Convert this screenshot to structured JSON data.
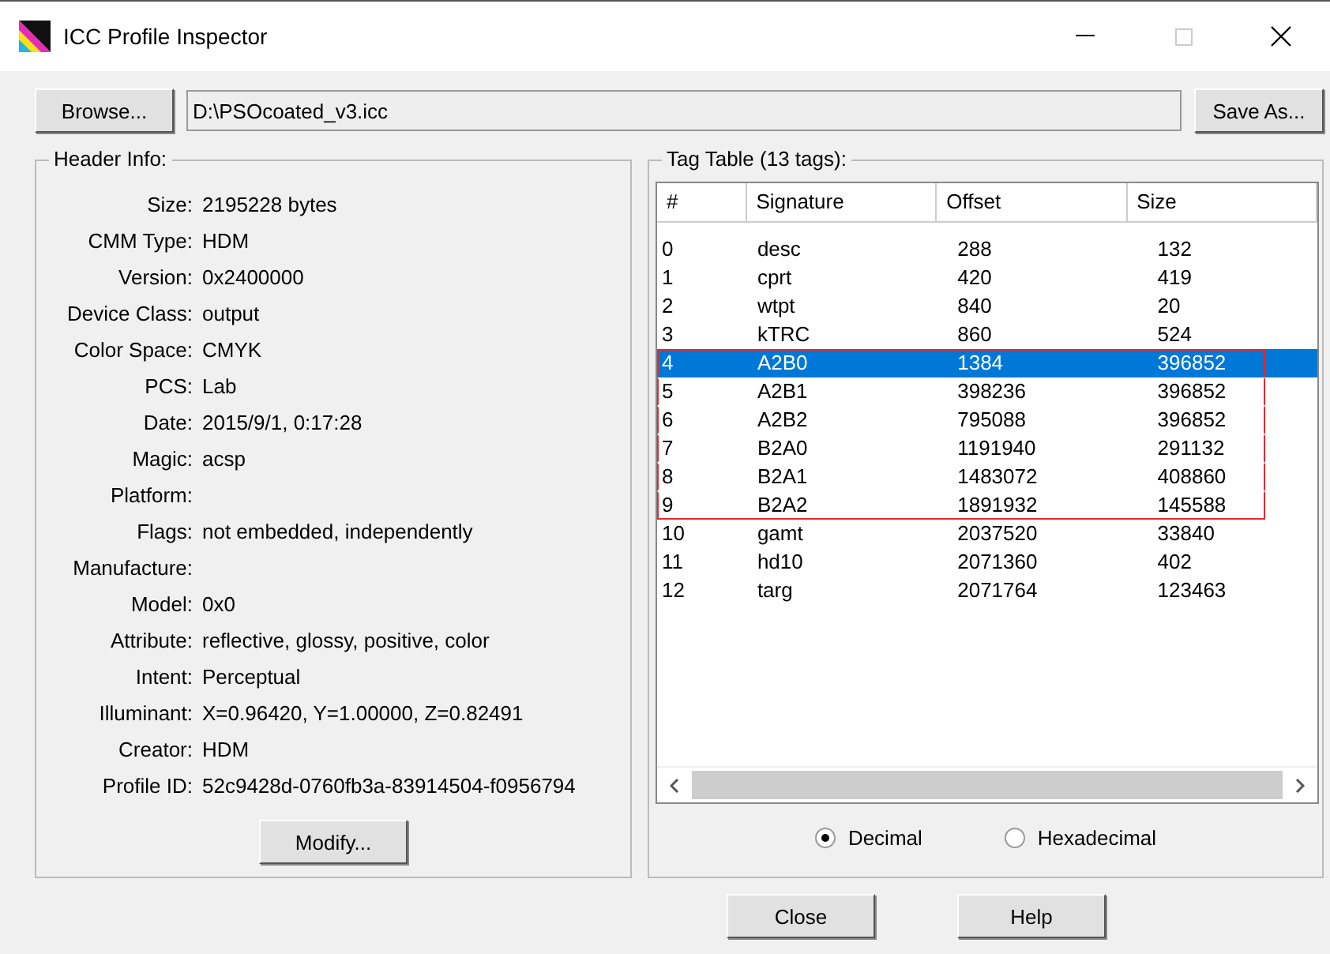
{
  "window": {
    "title": "ICC Profile Inspector"
  },
  "file_bar": {
    "browse_button": "Browse...",
    "path": "D:\\PSOcoated_v3.icc",
    "save_button": "Save As..."
  },
  "header_info": {
    "title": "Header Info:",
    "fields": [
      {
        "label": "Size:",
        "value": "2195228 bytes"
      },
      {
        "label": "CMM Type:",
        "value": "HDM"
      },
      {
        "label": "Version:",
        "value": "0x2400000"
      },
      {
        "label": "Device Class:",
        "value": "output"
      },
      {
        "label": "Color Space:",
        "value": "CMYK"
      },
      {
        "label": "PCS:",
        "value": "Lab"
      },
      {
        "label": "Date:",
        "value": "2015/9/1, 0:17:28"
      },
      {
        "label": "Magic:",
        "value": "acsp"
      },
      {
        "label": "Platform:"
      },
      {
        "label": "Flags:",
        "value": "not embedded, independently"
      },
      {
        "label": "Manufacture:"
      },
      {
        "label": "Model:",
        "value": "0x0"
      },
      {
        "label": "Attribute:",
        "value": "reflective, glossy, positive, color"
      },
      {
        "label": "Intent:",
        "value": "Perceptual"
      },
      {
        "label": "Illuminant:",
        "value": "X=0.96420, Y=1.00000, Z=0.82491"
      },
      {
        "label": "Creator:",
        "value": "HDM"
      },
      {
        "label": "Profile ID:",
        "value": "52c9428d-0760fb3a-83914504-f0956794"
      }
    ],
    "modify_button": "Modify..."
  },
  "tag_table": {
    "title": "Tag Table (13 tags):",
    "columns": [
      "#",
      "Signature",
      "Offset",
      "Size"
    ],
    "rows": [
      {
        "cells": [
          "0",
          "desc",
          "288",
          "132"
        ],
        "selected": false,
        "outlined": false
      },
      {
        "cells": [
          "1",
          "cprt",
          "420",
          "419"
        ],
        "selected": false,
        "outlined": false
      },
      {
        "cells": [
          "2",
          "wtpt",
          "840",
          "20"
        ],
        "selected": false,
        "outlined": false
      },
      {
        "cells": [
          "3",
          "kTRC",
          "860",
          "524"
        ],
        "selected": false,
        "outlined": false
      },
      {
        "cells": [
          "4",
          "A2B0",
          "1384",
          "396852"
        ],
        "selected": true,
        "outlined": true
      },
      {
        "cells": [
          "5",
          "A2B1",
          "398236",
          "396852"
        ],
        "selected": false,
        "outlined": true
      },
      {
        "cells": [
          "6",
          "A2B2",
          "795088",
          "396852"
        ],
        "selected": false,
        "outlined": true
      },
      {
        "cells": [
          "7",
          "B2A0",
          "1191940",
          "291132"
        ],
        "selected": false,
        "outlined": true
      },
      {
        "cells": [
          "8",
          "B2A1",
          "1483072",
          "408860"
        ],
        "selected": false,
        "outlined": true
      },
      {
        "cells": [
          "9",
          "B2A2",
          "1891932",
          "145588"
        ],
        "selected": false,
        "outlined": true
      },
      {
        "cells": [
          "10",
          "gamt",
          "2037520",
          "33840"
        ],
        "selected": false,
        "outlined": false
      },
      {
        "cells": [
          "11",
          "hd10",
          "2071360",
          "402"
        ],
        "selected": false,
        "outlined": false
      },
      {
        "cells": [
          "12",
          "targ",
          "2071764",
          "123463"
        ],
        "selected": false,
        "outlined": false
      }
    ],
    "radios": [
      {
        "label": "Decimal",
        "selected": true
      },
      {
        "label": "Hexadecimal",
        "selected": false
      }
    ]
  },
  "buttons": [
    "Close",
    "Help"
  ]
}
